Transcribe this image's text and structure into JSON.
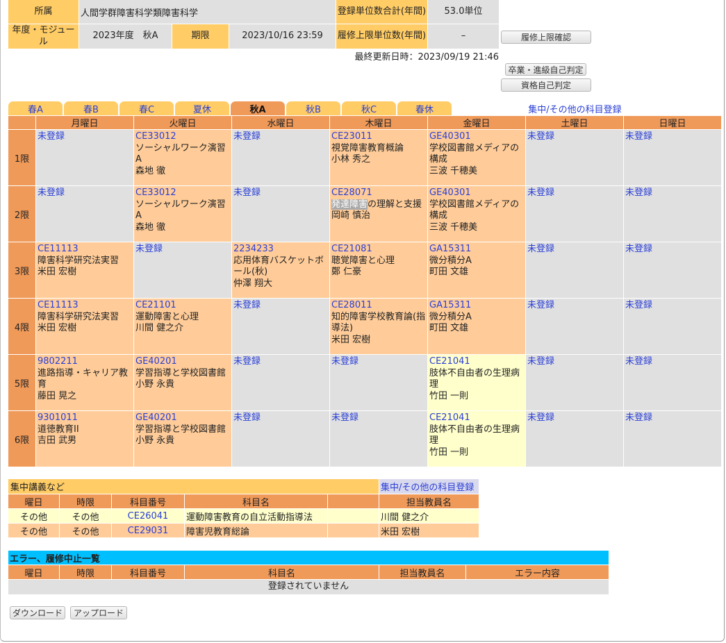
{
  "info": {
    "affiliation_label": "所属",
    "affiliation_value": "人間学群障害科学類障害科学",
    "credits_total_label": "登録単位数合計(年間)",
    "credits_total_value": "53.0単位",
    "year_module_label": "年度・モジュール",
    "year_module_value": "2023年度　秋A",
    "deadline_label": "期限",
    "deadline_value": "2023/10/16 23:59",
    "credits_limit_label": "履修上限単位数(年間)",
    "credits_limit_value": "–",
    "limit_check_button": "履修上限確認",
    "last_updated": "最終更新日時：2023/09/19 21:46",
    "graduation_check_button": "卒業・進級自己判定",
    "qualification_check_button": "資格自己判定"
  },
  "tabs": [
    {
      "label": "春A",
      "active": false
    },
    {
      "label": "春B",
      "active": false
    },
    {
      "label": "春C",
      "active": false
    },
    {
      "label": "夏休",
      "active": false
    },
    {
      "label": "秋A",
      "active": true
    },
    {
      "label": "秋B",
      "active": false
    },
    {
      "label": "秋C",
      "active": false
    },
    {
      "label": "春休",
      "active": false
    }
  ],
  "intensive_link": "集中/その他の科目登録",
  "timetable": {
    "days": [
      "月曜日",
      "火曜日",
      "水曜日",
      "木曜日",
      "金曜日",
      "土曜日",
      "日曜日"
    ],
    "periods": [
      "1限",
      "2限",
      "3限",
      "4限",
      "5限",
      "6限"
    ],
    "slots": [
      [
        {
          "code": "未登録",
          "title": "",
          "teacher": "",
          "state": "empty"
        },
        {
          "code": "CE33012",
          "title": "ソーシャルワーク演習A",
          "teacher": "森地 徹",
          "state": "reg"
        },
        {
          "code": "未登録",
          "title": "",
          "teacher": "",
          "state": "empty"
        },
        {
          "code": "CE23011",
          "title": "視覚障害教育概論",
          "teacher": "小林 秀之",
          "state": "reg"
        },
        {
          "code": "GE40301",
          "title": "学校図書館メディアの構成",
          "teacher": "三波 千穂美",
          "state": "reg"
        },
        {
          "code": "未登録",
          "title": "",
          "teacher": "",
          "state": "empty"
        },
        {
          "code": "未登録",
          "title": "",
          "teacher": "",
          "state": "empty"
        }
      ],
      [
        {
          "code": "未登録",
          "title": "",
          "teacher": "",
          "state": "empty"
        },
        {
          "code": "CE33012",
          "title": "ソーシャルワーク演習A",
          "teacher": "森地 徹",
          "state": "reg"
        },
        {
          "code": "未登録",
          "title": "",
          "teacher": "",
          "state": "empty"
        },
        {
          "code": "CE28071",
          "title_highlight": "発達障害",
          "title": "の理解と支援",
          "teacher": "岡崎 慎治",
          "state": "reg"
        },
        {
          "code": "GE40301",
          "title": "学校図書館メディアの構成",
          "teacher": "三波 千穂美",
          "state": "reg"
        },
        {
          "code": "未登録",
          "title": "",
          "teacher": "",
          "state": "empty"
        },
        {
          "code": "未登録",
          "title": "",
          "teacher": "",
          "state": "empty"
        }
      ],
      [
        {
          "code": "CE11113",
          "title": "障害科学研究法実習",
          "teacher": "米田 宏樹",
          "state": "reg"
        },
        {
          "code": "未登録",
          "title": "",
          "teacher": "",
          "state": "empty"
        },
        {
          "code": "2234233",
          "title": "応用体育バスケットボール(秋)",
          "teacher": "仲澤 翔大",
          "state": "reg"
        },
        {
          "code": "CE21081",
          "title": "聴覚障害と心理",
          "teacher": "鄭 仁豪",
          "state": "reg"
        },
        {
          "code": "GA15311",
          "title": "微分積分A",
          "teacher": "町田 文雄",
          "state": "reg"
        },
        {
          "code": "未登録",
          "title": "",
          "teacher": "",
          "state": "empty"
        },
        {
          "code": "未登録",
          "title": "",
          "teacher": "",
          "state": "empty"
        }
      ],
      [
        {
          "code": "CE11113",
          "title": "障害科学研究法実習",
          "teacher": "米田 宏樹",
          "state": "reg"
        },
        {
          "code": "CE21101",
          "title": "運動障害と心理",
          "teacher": "川間 健之介",
          "state": "reg"
        },
        {
          "code": "未登録",
          "title": "",
          "teacher": "",
          "state": "empty"
        },
        {
          "code": "CE28011",
          "title": "知的障害学校教育論(指導法)",
          "teacher": "米田 宏樹",
          "state": "reg"
        },
        {
          "code": "GA15311",
          "title": "微分積分A",
          "teacher": "町田 文雄",
          "state": "reg"
        },
        {
          "code": "未登録",
          "title": "",
          "teacher": "",
          "state": "empty"
        },
        {
          "code": "未登録",
          "title": "",
          "teacher": "",
          "state": "empty"
        }
      ],
      [
        {
          "code": "9802211",
          "title": "進路指導・キャリア教育",
          "teacher": "藤田 晃之",
          "state": "reg"
        },
        {
          "code": "GE40201",
          "title": "学習指導と学校図書館",
          "teacher": "小野 永貴",
          "state": "reg"
        },
        {
          "code": "未登録",
          "title": "",
          "teacher": "",
          "state": "empty"
        },
        {
          "code": "未登録",
          "title": "",
          "teacher": "",
          "state": "empty"
        },
        {
          "code": "CE21041",
          "title": "肢体不自由者の生理病理",
          "teacher": "竹田 一則",
          "state": "reg2"
        },
        {
          "code": "未登録",
          "title": "",
          "teacher": "",
          "state": "empty"
        },
        {
          "code": "未登録",
          "title": "",
          "teacher": "",
          "state": "empty"
        }
      ],
      [
        {
          "code": "9301011",
          "title": "道徳教育II",
          "teacher": "吉田 武男",
          "state": "reg"
        },
        {
          "code": "GE40201",
          "title": "学習指導と学校図書館",
          "teacher": "小野 永貴",
          "state": "reg"
        },
        {
          "code": "未登録",
          "title": "",
          "teacher": "",
          "state": "empty"
        },
        {
          "code": "未登録",
          "title": "",
          "teacher": "",
          "state": "empty"
        },
        {
          "code": "CE21041",
          "title": "肢体不自由者の生理病理",
          "teacher": "竹田 一則",
          "state": "reg2"
        },
        {
          "code": "未登録",
          "title": "",
          "teacher": "",
          "state": "empty"
        },
        {
          "code": "未登録",
          "title": "",
          "teacher": "",
          "state": "empty"
        }
      ]
    ]
  },
  "intensive": {
    "title": "集中講義など",
    "link": "集中/その他の科目登録",
    "headers": [
      "曜日",
      "時限",
      "科目番号",
      "科目名",
      "",
      "担当教員名"
    ],
    "rows": [
      [
        "その他",
        "その他",
        "CE26041",
        "運動障害教育の自立活動指導法",
        "",
        "川間 健之介"
      ],
      [
        "その他",
        "その他",
        "CE29031",
        "障害児教育総論",
        "",
        "米田 宏樹"
      ]
    ]
  },
  "errors": {
    "title": "エラー、履修中止一覧",
    "headers": [
      "曜日",
      "時限",
      "科目番号",
      "科目名",
      "担当教員名",
      "エラー内容"
    ],
    "empty_message": "登録されていません"
  },
  "footer": {
    "download_button": "ダウンロード",
    "upload_button": "アップロード"
  },
  "colors": {
    "label_bg": "#ffcc66",
    "header_bg": "#f09a5a",
    "registered_bg": "#ffcc99",
    "registered_alt_bg": "#ffffcc",
    "empty_bg": "#e0e0e0",
    "link": "#2a3fd6",
    "error_title_bg": "#00bfff"
  }
}
